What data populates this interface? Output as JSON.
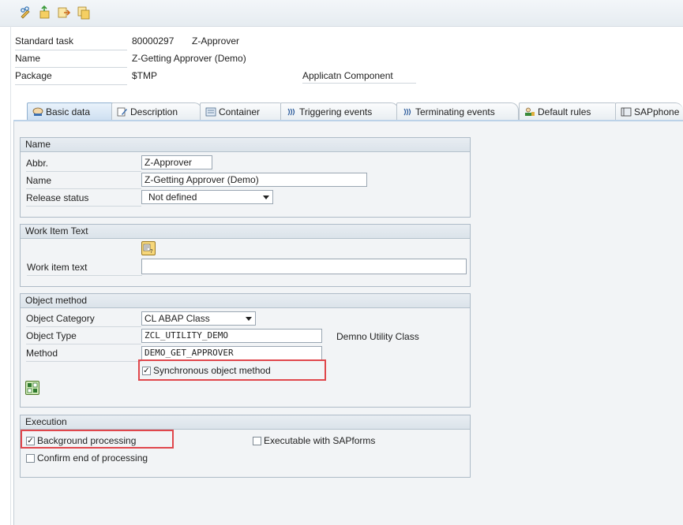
{
  "toolbar": {
    "icons": [
      "display-change-icon",
      "activate-icon",
      "transport-icon",
      "copy-icon"
    ]
  },
  "header": {
    "standard_task_label": "Standard task",
    "standard_task_id": "80000297",
    "standard_task_abbr": "Z-Approver",
    "name_label": "Name",
    "name_value": "Z-Getting Approver (Demo)",
    "package_label": "Package",
    "package_value": "$TMP",
    "app_component_label": "Applicatn Component"
  },
  "tabs": [
    {
      "label": "Basic data",
      "icon": "person-icon",
      "active": true
    },
    {
      "label": "Description",
      "icon": "pencil-icon",
      "active": false
    },
    {
      "label": "Container",
      "icon": "container-icon",
      "active": false
    },
    {
      "label": "Triggering events",
      "icon": "event-icon",
      "active": false
    },
    {
      "label": "Terminating events",
      "icon": "event-icon",
      "active": false
    },
    {
      "label": "Default rules",
      "icon": "user-rule-icon",
      "active": false
    },
    {
      "label": "SAPphone",
      "icon": "phone-book-icon",
      "active": false
    }
  ],
  "name_group": {
    "title": "Name",
    "abbr_label": "Abbr.",
    "abbr_value": "Z-Approver",
    "name_label": "Name",
    "name_value": "Z-Getting Approver (Demo)",
    "release_label": "Release status",
    "release_value": "Not defined"
  },
  "work_item_group": {
    "title": "Work Item Text",
    "text_label": "Work item text",
    "text_value": ""
  },
  "object_method_group": {
    "title": "Object method",
    "category_label": "Object Category",
    "category_value": "CL ABAP Class",
    "type_label": "Object Type",
    "type_value": "ZCL_UTILITY_DEMO",
    "type_description": "Demno Utility Class",
    "method_label": "Method",
    "method_value": "DEMO_GET_APPROVER",
    "synchronous_label": "Synchronous object method",
    "synchronous_checked": true
  },
  "execution_group": {
    "title": "Execution",
    "background_label": "Background processing",
    "background_checked": true,
    "confirm_label": "Confirm end of processing",
    "confirm_checked": false,
    "sapforms_label": "Executable with SAPforms",
    "sapforms_checked": false
  },
  "colors": {
    "highlight": "#e0474c",
    "active_tab": "#cfe0f1",
    "panel_bg": "#f2f4f6"
  }
}
